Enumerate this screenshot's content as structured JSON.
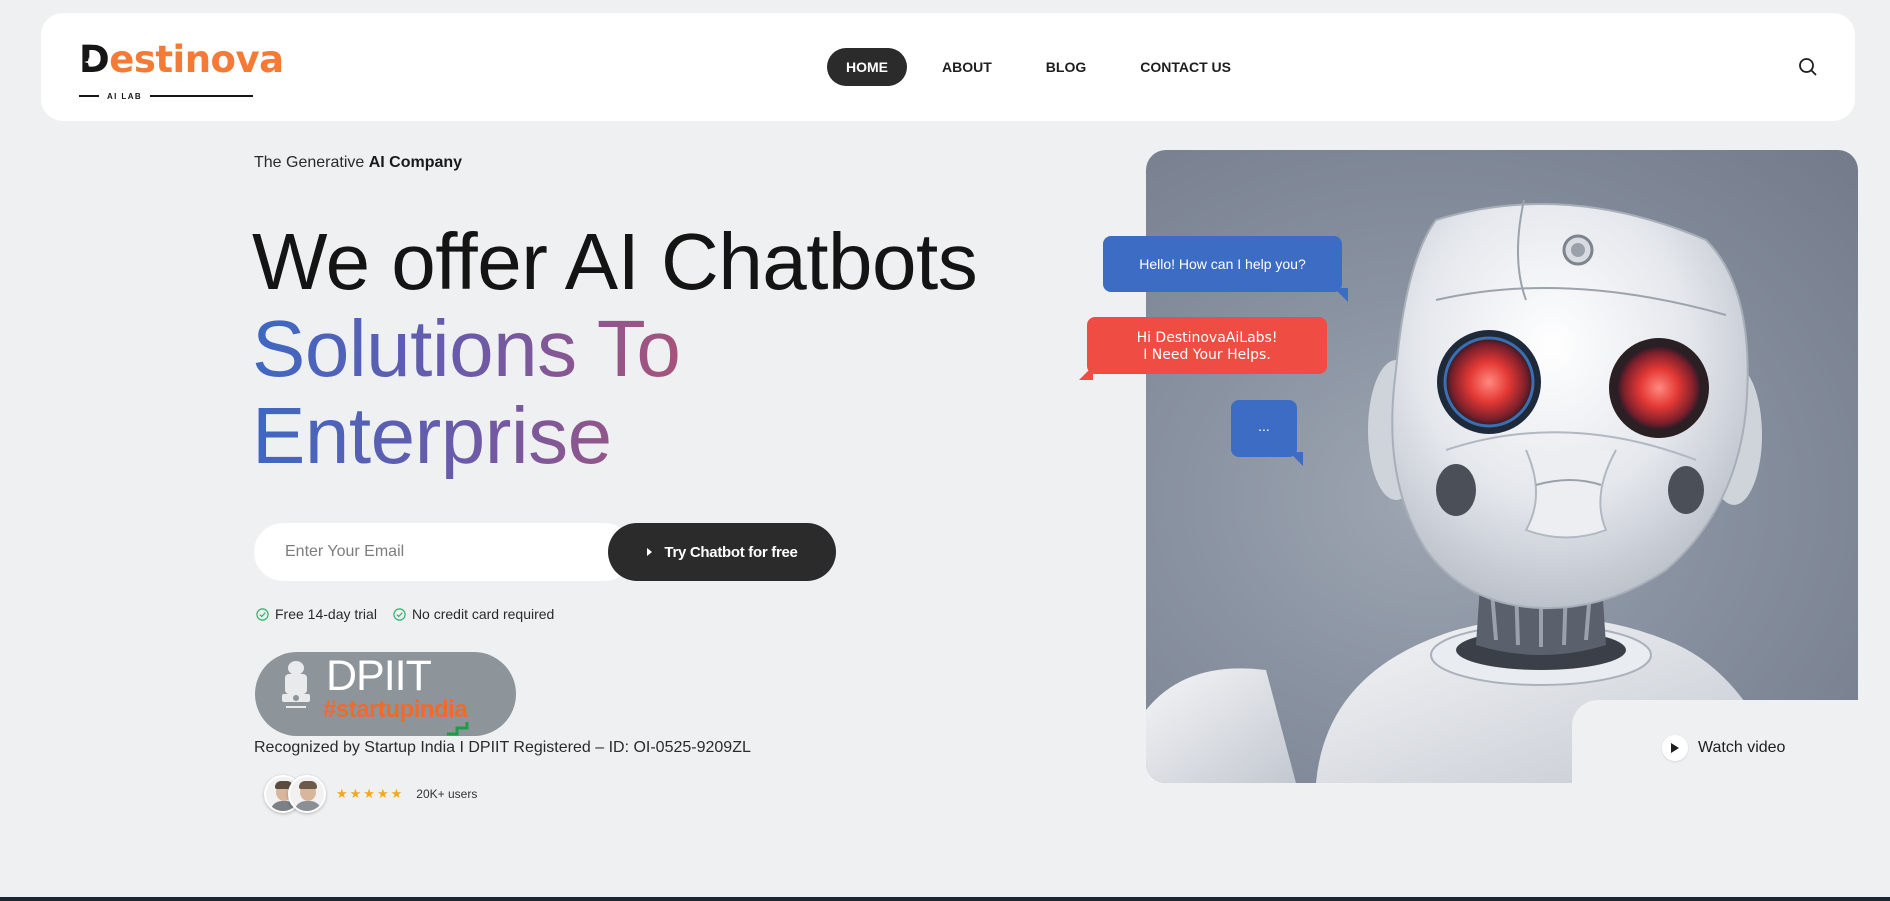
{
  "header": {
    "logo_text": "Destinova",
    "logo_subtext": "AI LAB",
    "nav": [
      {
        "label": "HOME",
        "active": true
      },
      {
        "label": "ABOUT",
        "active": false
      },
      {
        "label": "BLOG",
        "active": false
      },
      {
        "label": "CONTACT US",
        "active": false
      }
    ],
    "search_icon": "search-icon"
  },
  "hero": {
    "tagline_prefix": "The Generative ",
    "tagline_bold": "AI Company",
    "headline_line1": "We offer AI Chatbots",
    "headline_line2": "Solutions To",
    "headline_line3": "Enterprise",
    "email_placeholder": "Enter Your Email",
    "cta_label": "Try Chatbot for free",
    "checks": [
      "Free 14-day trial",
      "No credit card required"
    ],
    "badge_title": "DPIIT",
    "badge_hashtag": "#startupindia",
    "recognized_text": "Recognized by Startup India I DPIIT Registered – ID: OI-0525-9209ZL",
    "rating_stars": 5,
    "stars_text": "★★★★★",
    "users_count": "20K+ users"
  },
  "chat": {
    "bubble1": "Hello! How can I help you?",
    "bubble2_line1": "Hi DestinovaAiLabs!",
    "bubble2_line2": "I Need Your Helps.",
    "bubble3": "..."
  },
  "video": {
    "label": "Watch video"
  },
  "colors": {
    "brand_orange": "#f47a36",
    "dark": "#2b2b2b",
    "chat_blue": "#3c6cc4",
    "chat_red": "#ef4d43",
    "star": "#f2a81d"
  }
}
